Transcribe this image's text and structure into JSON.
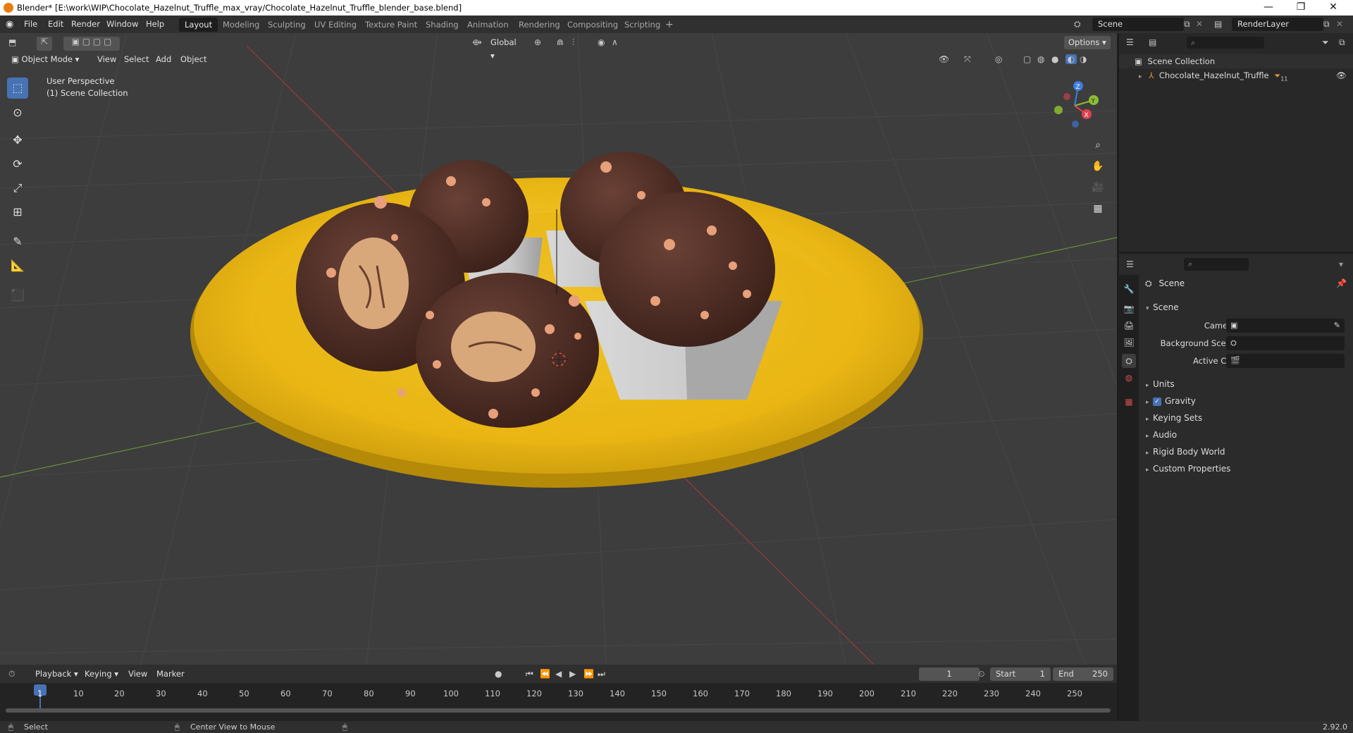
{
  "window": {
    "title": "Blender* [E:\\work\\WIP\\Chocolate_Hazelnut_Truffle_max_vray/Chocolate_Hazelnut_Truffle_blender_base.blend]",
    "minimize": "—",
    "restore": "❐",
    "close": "✕"
  },
  "menu": {
    "items": [
      "File",
      "Edit",
      "Render",
      "Window",
      "Help"
    ]
  },
  "workspaces": {
    "tabs": [
      "Layout",
      "Modeling",
      "Sculpting",
      "UV Editing",
      "Texture Paint",
      "Shading",
      "Animation",
      "Rendering",
      "Compositing",
      "Scripting"
    ],
    "active": "Layout",
    "add": "+"
  },
  "scene_selector": {
    "value": "Scene"
  },
  "layer_selector": {
    "value": "RenderLayer"
  },
  "viewport": {
    "transform_orientation": "Global",
    "options_label": "Options",
    "mode": "Object Mode",
    "menus": [
      "View",
      "Select",
      "Add",
      "Object"
    ],
    "overlay_text": {
      "line1": "User Perspective",
      "line2": "(1) Scene Collection"
    },
    "gizmo": {
      "z": "Z",
      "y": "Y",
      "x": "X"
    }
  },
  "outliner": {
    "root": "Scene Collection",
    "items": [
      {
        "label": "Chocolate_Hazelnut_Truffle",
        "badge": "11"
      }
    ]
  },
  "properties": {
    "context": "Scene",
    "panel_title": "Scene",
    "fields": {
      "camera": "Camera",
      "background_scene": "Background Scene",
      "active_clip": "Active Clip"
    },
    "panels": [
      "Units",
      "Gravity",
      "Keying Sets",
      "Audio",
      "Rigid Body World",
      "Custom Properties"
    ],
    "gravity_checked": true
  },
  "timeline": {
    "menus": [
      "Playback",
      "Keying",
      "View",
      "Marker"
    ],
    "current_frame": "1",
    "start_label": "Start",
    "start_value": "1",
    "end_label": "End",
    "end_value": "250",
    "ruler": [
      "1",
      "10",
      "20",
      "30",
      "40",
      "50",
      "60",
      "70",
      "80",
      "90",
      "100",
      "110",
      "120",
      "130",
      "140",
      "150",
      "160",
      "170",
      "180",
      "190",
      "200",
      "210",
      "220",
      "230",
      "240",
      "250"
    ]
  },
  "statusbar": {
    "left": "Select",
    "middle": "Center View to Mouse",
    "version": "2.92.0"
  },
  "colors": {
    "accent": "#4772b3",
    "plate": "#f2c21a",
    "chocolate": "#4a2a22",
    "cup": "#cfcfcf",
    "grid_bg": "#3d3d3d"
  }
}
